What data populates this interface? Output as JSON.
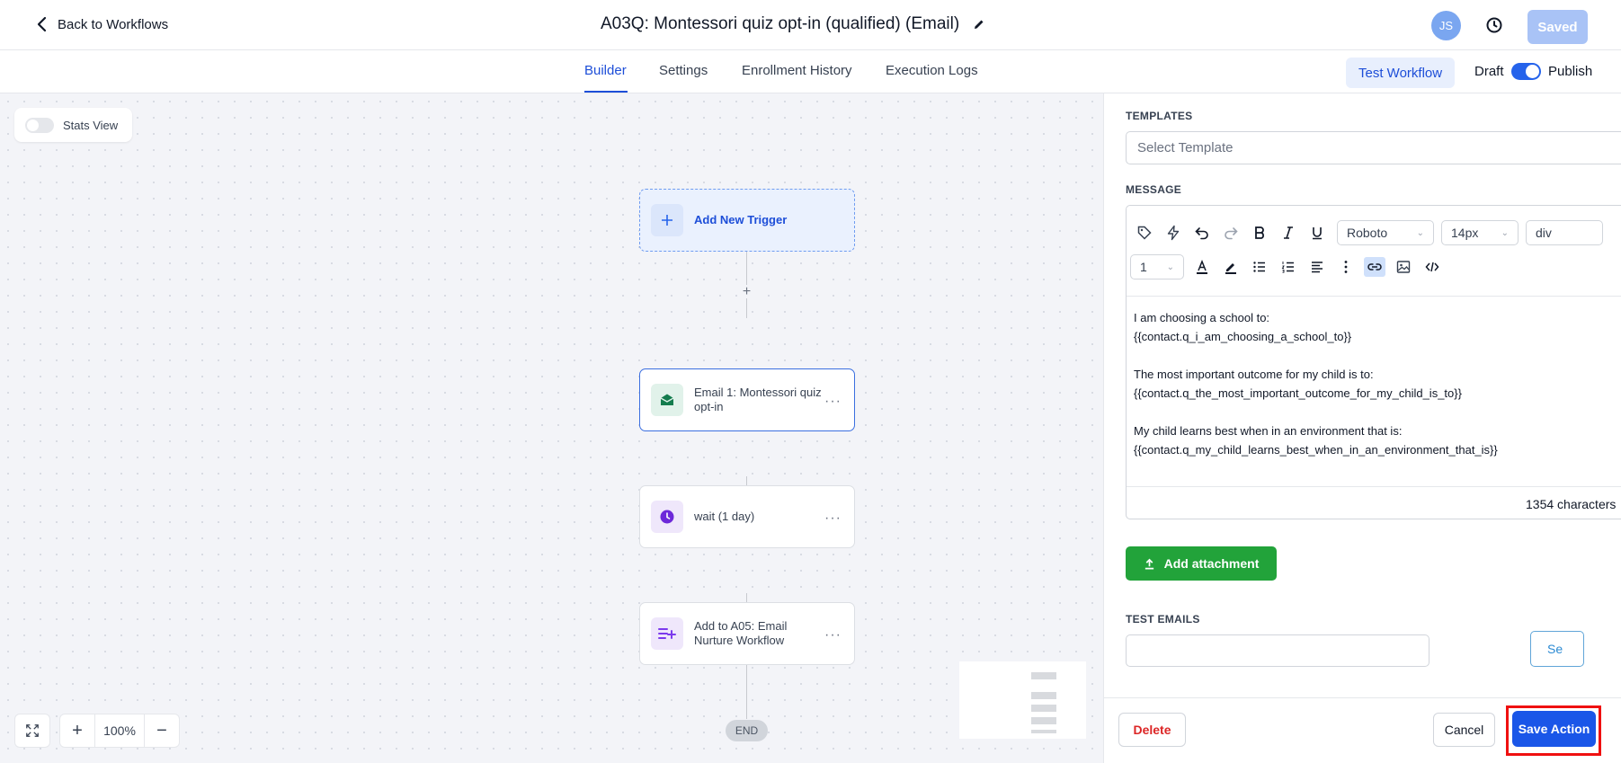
{
  "header": {
    "back_label": "Back to Workflows",
    "title": "A03Q: Montessori quiz opt-in (qualified) (Email)",
    "avatar_initials": "JS",
    "saved_label": "Saved"
  },
  "tabs": [
    {
      "label": "Builder",
      "active": true
    },
    {
      "label": "Settings",
      "active": false
    },
    {
      "label": "Enrollment History",
      "active": false
    },
    {
      "label": "Execution Logs",
      "active": false
    }
  ],
  "toolbar": {
    "test_workflow_label": "Test Workflow",
    "draft_label": "Draft",
    "publish_label": "Publish",
    "publish_toggle_on": true
  },
  "canvas": {
    "stats_view_label": "Stats View",
    "zoom": "100%",
    "end_label": "END",
    "nodes": [
      {
        "label": "Add New Trigger",
        "icon": "plus-icon"
      },
      {
        "label": "Email 1: Montessori quiz opt-in",
        "icon": "email-icon",
        "selected": true
      },
      {
        "label": "wait (1 day)",
        "icon": "clock-icon"
      },
      {
        "label": "Add to A05: Email Nurture Workflow",
        "icon": "add-to-workflow-icon"
      }
    ]
  },
  "panel": {
    "templates_label": "TEMPLATES",
    "template_placeholder": "Select Template",
    "message_label": "MESSAGE",
    "font_family": "Roboto",
    "font_size": "14px",
    "block_type": "div",
    "line_height": "1",
    "body": [
      {
        "line1": "I am choosing a school to:",
        "line2": "{{contact.q_i_am_choosing_a_school_to}}"
      },
      {
        "line1": "The most important outcome for my child is to:",
        "line2": "{{contact.q_the_most_important_outcome_for_my_child_is_to}}"
      },
      {
        "line1": "My child learns best when in an environment that is:",
        "line2": "{{contact.q_my_child_learns_best_when_in_an_environment_that_is}}"
      }
    ],
    "char_count": "1354 characters",
    "attach_label": "Add attachment",
    "test_emails_label": "TEST EMAILS",
    "send_partial_label": "Se",
    "delete_label": "Delete",
    "cancel_label": "Cancel",
    "save_label": "Save Action"
  },
  "colors": {
    "accent": "#1a56e8",
    "success": "#22a33a",
    "danger": "#dc2626",
    "highlight": "#ef1010"
  }
}
